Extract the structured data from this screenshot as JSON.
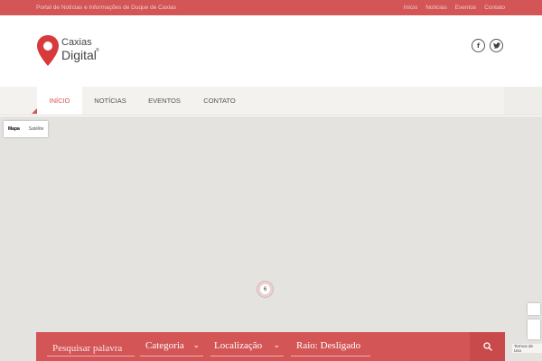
{
  "topbar": {
    "tagline": "Portal de Notícias e Informações de Duque de Caxias",
    "links": [
      "Início",
      "Notícias",
      "Eventos",
      "Contato"
    ]
  },
  "logo": {
    "line1": "Caxias",
    "line2": "Digital",
    "reg": "®"
  },
  "social": {
    "facebook": "f",
    "twitter": "t"
  },
  "nav": {
    "items": [
      "INÍCIO",
      "NOTÍCIAS",
      "EVENTOS",
      "CONTATO"
    ],
    "active": "INÍCIO"
  },
  "map": {
    "type_options": [
      "Mapa",
      "Satélite"
    ],
    "selected_type": "Mapa",
    "cluster_count": "6",
    "terms": "Termos de Uso"
  },
  "search": {
    "keyword_placeholder": "Pesquisar palavra",
    "category": "Categoria",
    "location": "Localização",
    "radius": "Raio: Desligado"
  },
  "colors": {
    "brand": "#d35556",
    "map_bg": "#e5e3df",
    "nav_bg": "#f3f2ef"
  },
  "icons": [
    "map-pin-logo-icon",
    "facebook-icon",
    "twitter-icon",
    "chevron-down-icon",
    "search-icon"
  ]
}
